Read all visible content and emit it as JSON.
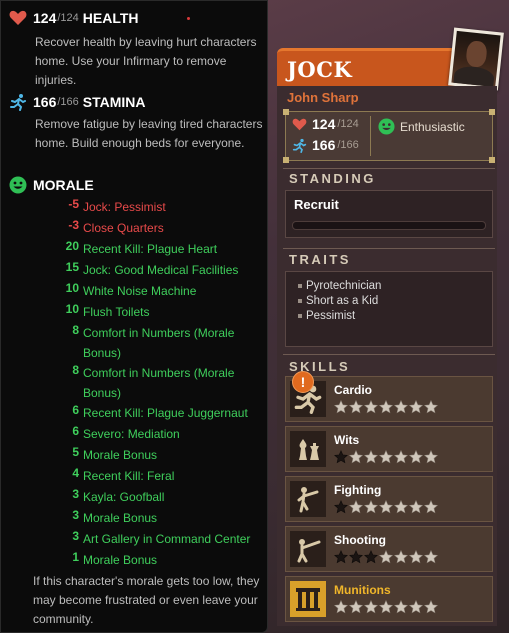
{
  "tooltip": {
    "health": {
      "current": "124",
      "max": "/124",
      "label": "HEALTH",
      "desc": "Recover health by leaving hurt characters home. Use your Infirmary to remove injuries."
    },
    "stamina": {
      "current": "166",
      "max": "/166",
      "label": "STAMINA",
      "desc": "Remove fatigue by leaving tired characters home. Build enough beds for everyone."
    },
    "morale": {
      "label": "MORALE"
    },
    "modifiers": [
      {
        "value": "-5",
        "text": "Jock: Pessimist",
        "kind": "neg"
      },
      {
        "value": "-3",
        "text": "Close Quarters",
        "kind": "neg"
      },
      {
        "value": "20",
        "text": "Recent Kill: Plague Heart",
        "kind": "pos"
      },
      {
        "value": "15",
        "text": "Jock: Good Medical Facilities",
        "kind": "pos"
      },
      {
        "value": "10",
        "text": "White Noise Machine",
        "kind": "pos"
      },
      {
        "value": "10",
        "text": "Flush Toilets",
        "kind": "pos"
      },
      {
        "value": "8",
        "text": "Comfort in Numbers (Morale Bonus)",
        "kind": "pos"
      },
      {
        "value": "8",
        "text": "Comfort in Numbers (Morale Bonus)",
        "kind": "pos"
      },
      {
        "value": "6",
        "text": "Recent Kill: Plague Juggernaut",
        "kind": "pos"
      },
      {
        "value": "6",
        "text": "Severo: Mediation",
        "kind": "pos"
      },
      {
        "value": "5",
        "text": "Morale Bonus",
        "kind": "pos"
      },
      {
        "value": "4",
        "text": "Recent Kill: Feral",
        "kind": "pos"
      },
      {
        "value": "3",
        "text": "Kayla: Goofball",
        "kind": "pos"
      },
      {
        "value": "3",
        "text": "Morale Bonus",
        "kind": "pos"
      },
      {
        "value": "3",
        "text": "Art Gallery in Command Center",
        "kind": "pos"
      },
      {
        "value": "1",
        "text": "Morale Bonus",
        "kind": "pos"
      }
    ],
    "footer": "If this character's morale gets too low, they may become frustrated or even leave your community."
  },
  "card": {
    "nickname": "JOCK",
    "full_name": "John Sharp",
    "health_current": "124",
    "health_max": "/124",
    "stamina_current": "166",
    "stamina_max": "/166",
    "mood": "Enthusiastic",
    "standing_title": "STANDING",
    "standing_rank": "Recruit",
    "standing_progress": 0.0,
    "traits_title": "TRAITS",
    "traits": [
      "Pyrotechnician",
      "Short as a Kid",
      "Pessimist"
    ],
    "skills_title": "SKILLS",
    "skills": [
      {
        "name": "Cardio",
        "icon": "running-icon",
        "filled": 0,
        "max": 7,
        "alert": "!"
      },
      {
        "name": "Wits",
        "icon": "chess-icon",
        "filled": 1,
        "max": 7
      },
      {
        "name": "Fighting",
        "icon": "kick-icon",
        "filled": 1,
        "max": 7
      },
      {
        "name": "Shooting",
        "icon": "rifle-icon",
        "filled": 3,
        "max": 7
      },
      {
        "name": "Munitions",
        "icon": "munitions-icon",
        "filled": 0,
        "max": 7,
        "highlight": true
      }
    ]
  },
  "colors": {
    "negative": "#e84a4a",
    "positive": "#3fcf5c",
    "accent": "#c8561d",
    "gold": "#f0b62a"
  }
}
